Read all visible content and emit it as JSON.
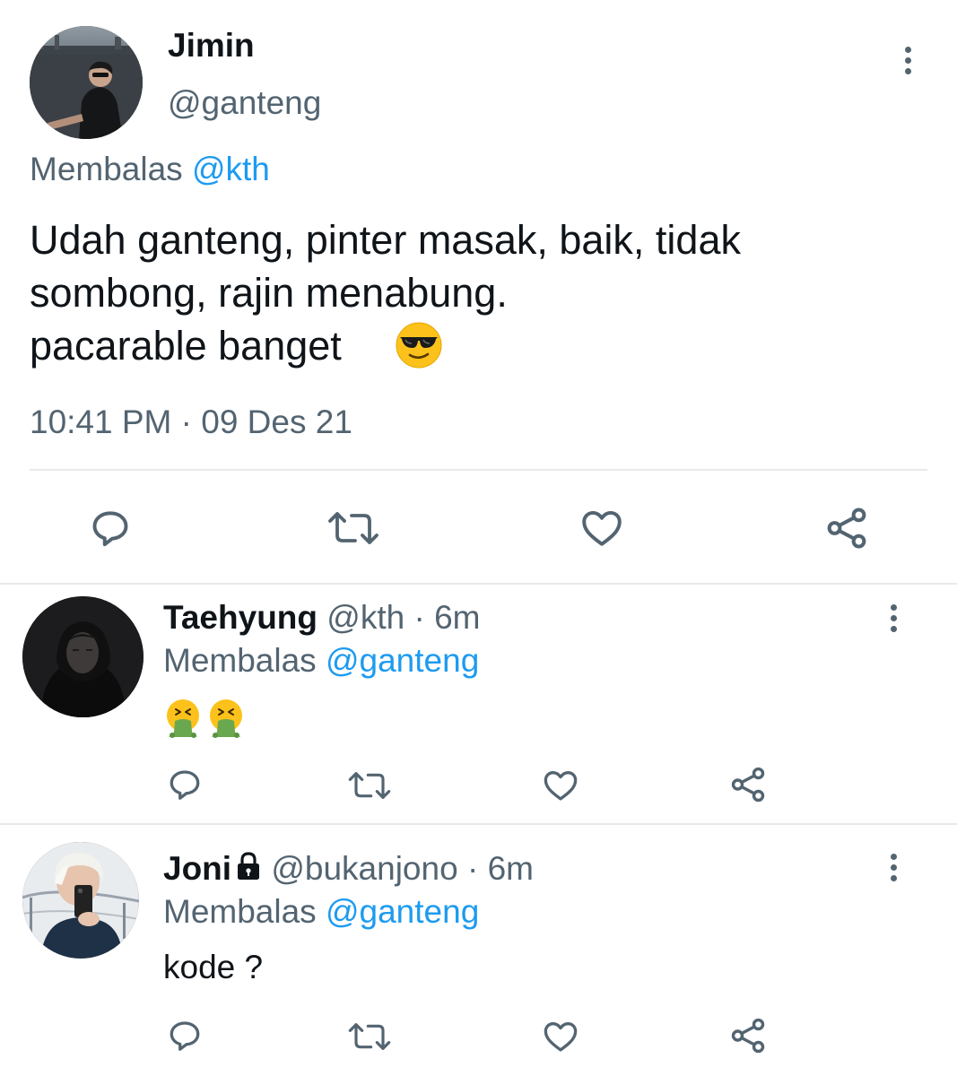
{
  "main_tweet": {
    "author_name": "Jimin",
    "author_handle": "@ganteng",
    "replying_prefix": "Membalas",
    "replying_to": "@kth",
    "text": "Udah ganteng, pinter masak, baik, tidak\nsombong, rajin menabung.\npacarable banget",
    "text_emoji": "smiling-face-with-sunglasses",
    "timestamp": "10:41 PM · 09 Des 21"
  },
  "replies": [
    {
      "author_name": "Taehyung",
      "author_handle": "@kth",
      "separator": "·",
      "time": "6m",
      "replying_prefix": "Membalas",
      "replying_to": "@ganteng",
      "text": "",
      "emoji": [
        "nauseated-face",
        "nauseated-face"
      ],
      "locked": false
    },
    {
      "author_name": "Joni",
      "author_handle": "@bukanjono",
      "separator": "·",
      "time": "6m",
      "replying_prefix": "Membalas",
      "replying_to": "@ganteng",
      "text": "kode ?",
      "locked": true
    }
  ],
  "icons": {
    "actions": [
      "reply-icon",
      "retweet-icon",
      "like-icon",
      "share-icon"
    ],
    "menu": "more-vertical-icon",
    "lock": "lock-icon"
  },
  "colors": {
    "text_primary": "#0f1419",
    "text_secondary": "#536471",
    "accent": "#1d9bf0",
    "divider": "#e7e9ea"
  }
}
